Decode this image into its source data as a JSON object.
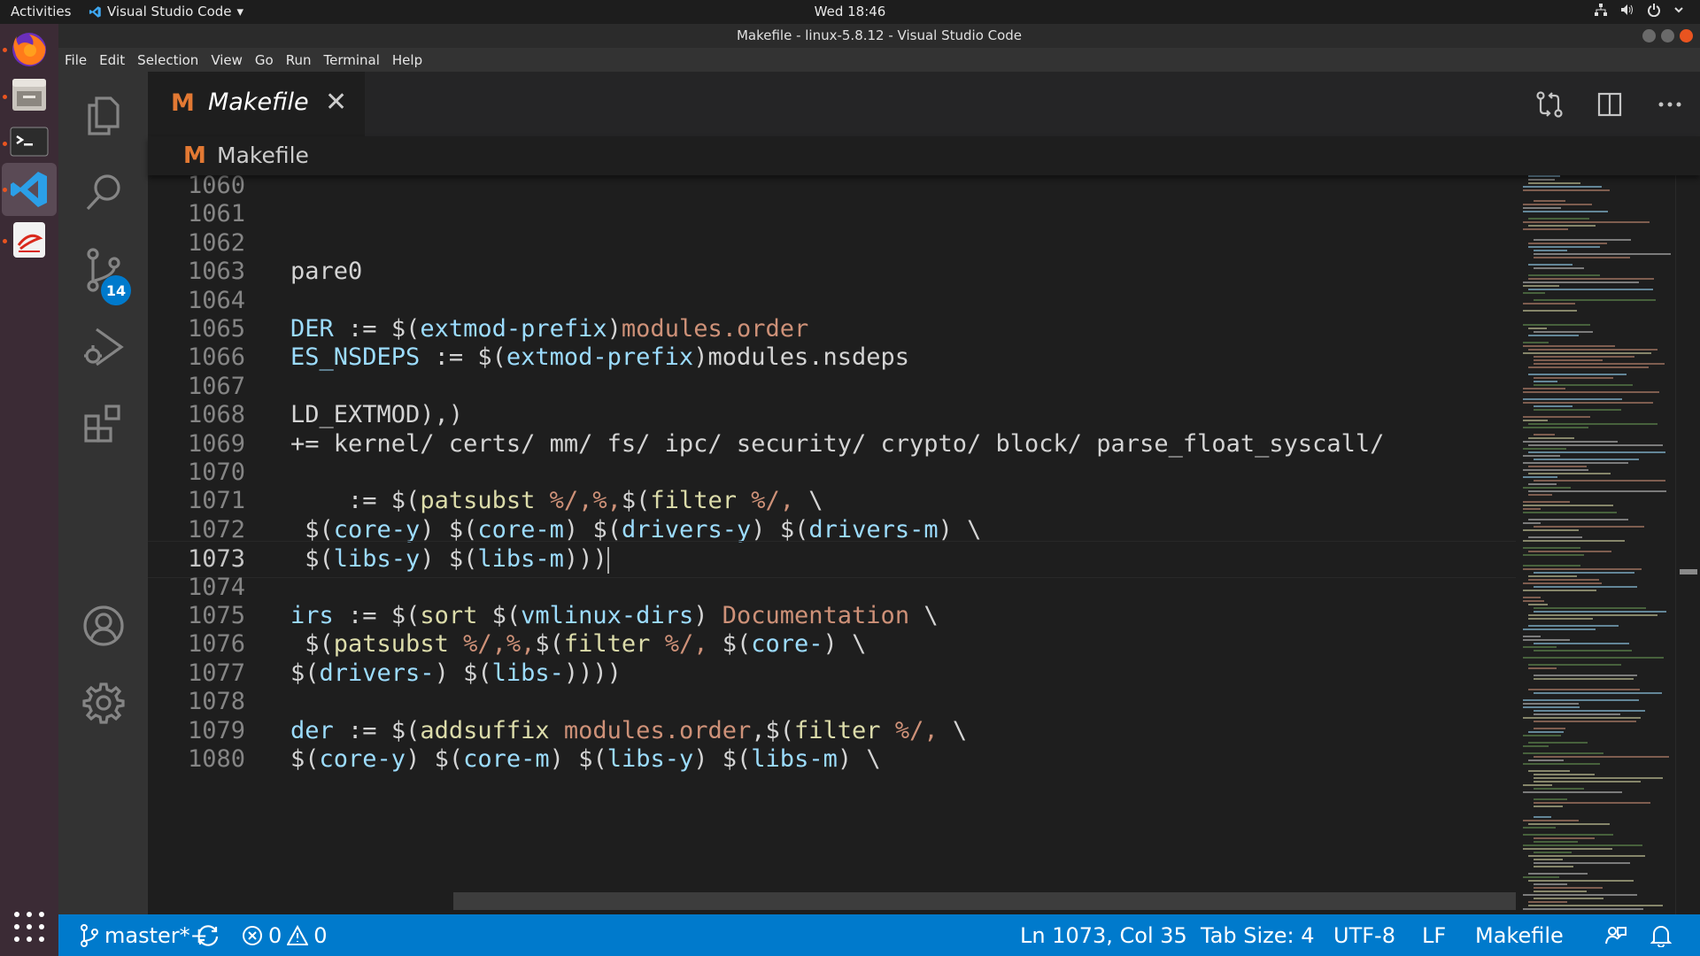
{
  "topbar": {
    "activities": "Activities",
    "app_name": "Visual Studio Code",
    "app_menu_arrow": "▾",
    "clock": "Wed 18:46",
    "tray_icons": [
      "network-icon",
      "volume-icon",
      "power-icon",
      "chevron-down-icon"
    ]
  },
  "dock": {
    "apps": [
      "firefox-icon",
      "files-icon",
      "terminal-icon",
      "vscode-icon",
      "text-editor-icon"
    ]
  },
  "window": {
    "title": "Makefile - linux-5.8.12 - Visual Studio Code"
  },
  "menu": [
    "File",
    "Edit",
    "Selection",
    "View",
    "Go",
    "Run",
    "Terminal",
    "Help"
  ],
  "activity_bar": {
    "scm_badge": "14",
    "items": [
      "explorer-icon",
      "search-icon",
      "source-control-icon",
      "run-debug-icon",
      "extensions-icon",
      "accounts-icon",
      "settings-gear-icon"
    ]
  },
  "tab": {
    "icon_letter": "M",
    "label": "Makefile",
    "close": "✕"
  },
  "breadcrumb": {
    "icon_letter": "M",
    "label": "Makefile"
  },
  "editor": {
    "lines": [
      {
        "n": "1060",
        "code": ""
      },
      {
        "n": "1061",
        "code": ""
      },
      {
        "n": "1062",
        "code": ""
      },
      {
        "n": "1063",
        "code": "pare0"
      },
      {
        "n": "1064",
        "code": ""
      },
      {
        "n": "1065",
        "code": "DER := $(extmod-prefix)modules.order"
      },
      {
        "n": "1066",
        "code": "ES_NSDEPS := $(extmod-prefix)modules.nsdeps"
      },
      {
        "n": "1067",
        "code": ""
      },
      {
        "n": "1068",
        "code": "LD_EXTMOD),)"
      },
      {
        "n": "1069",
        "code": "+= kernel/ certs/ mm/ fs/ ipc/ security/ crypto/ block/ parse_float_syscall/"
      },
      {
        "n": "1070",
        "code": ""
      },
      {
        "n": "1071",
        "code": "    := $(patsubst %/,%,$(filter %/, \\"
      },
      {
        "n": "1072",
        "code": " $(core-y) $(core-m) $(drivers-y) $(drivers-m) \\"
      },
      {
        "n": "1073",
        "code": " $(libs-y) $(libs-m)))"
      },
      {
        "n": "1074",
        "code": ""
      },
      {
        "n": "1075",
        "code": "irs := $(sort $(vmlinux-dirs) Documentation \\"
      },
      {
        "n": "1076",
        "code": " $(patsubst %/,%,$(filter %/, $(core-) \\"
      },
      {
        "n": "1077",
        "code": "$(drivers-) $(libs-))))"
      },
      {
        "n": "1078",
        "code": ""
      },
      {
        "n": "1079",
        "code": "der := $(addsuffix modules.order,$(filter %/, \\"
      },
      {
        "n": "1080",
        "code": "$(core-y) $(core-m) $(libs-y) $(libs-m) \\"
      }
    ],
    "current_line": "1073"
  },
  "statusbar": {
    "branch": "master*+",
    "errors": "0",
    "warnings": "0",
    "position": "Ln 1073, Col 35",
    "tab_size": "Tab Size: 4",
    "encoding": "UTF-8",
    "eol": "LF",
    "language": "Makefile"
  },
  "colors": {
    "accent": "#007acc",
    "makefile_icon": "#e37933",
    "ubuntu_orange": "#e95420"
  }
}
